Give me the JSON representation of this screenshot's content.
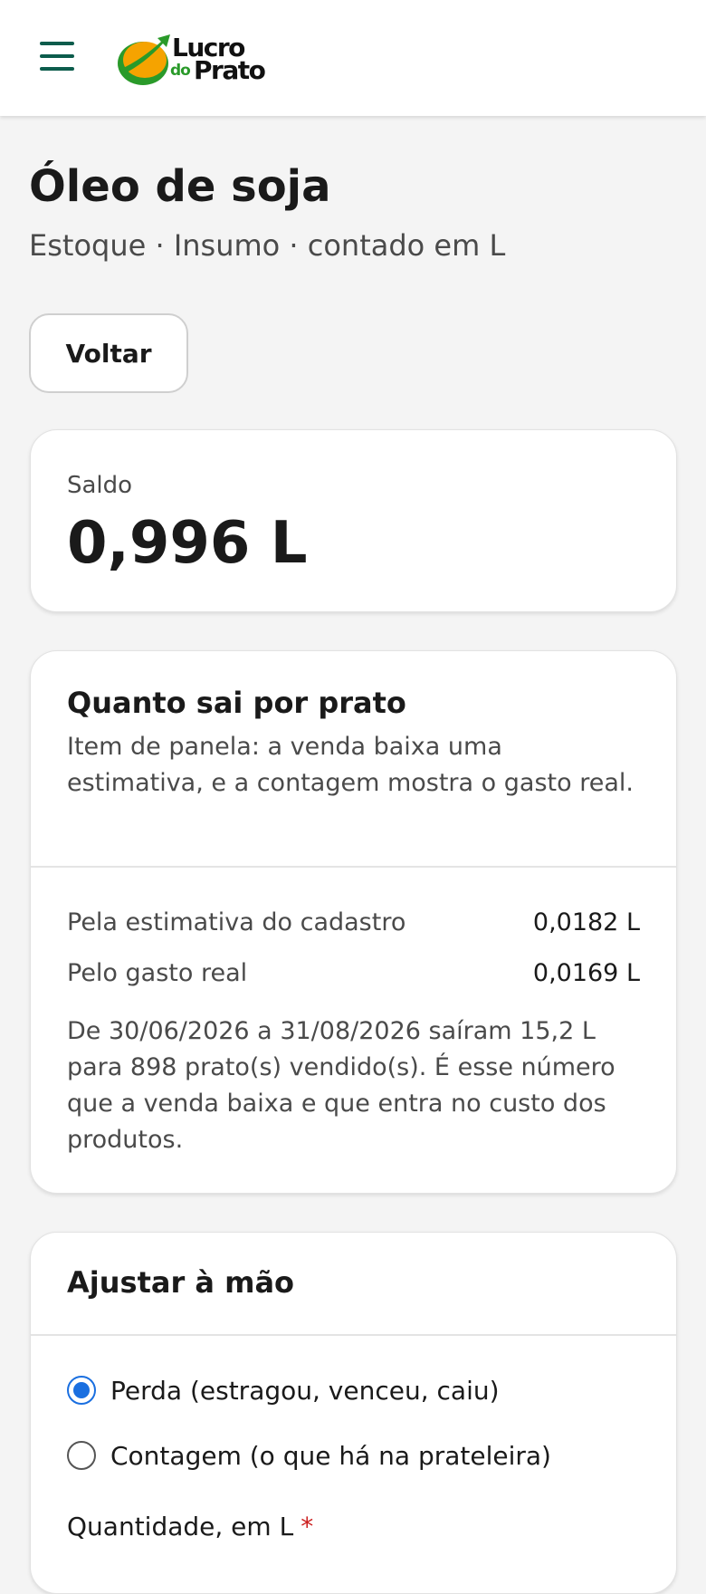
{
  "header": {
    "logo_line1": "Lucro",
    "logo_line2a": "do",
    "logo_line2b": "Prato"
  },
  "page": {
    "title": "Óleo de soja",
    "subtitle": "Estoque · Insumo · contado em L",
    "back_label": "Voltar"
  },
  "saldo": {
    "label": "Saldo",
    "value": "0,996 L"
  },
  "por_prato": {
    "title": "Quanto sai por prato",
    "description": "Item de panela: a venda baixa uma estimativa, e a contagem mostra o gasto real.",
    "rows": [
      {
        "label": "Pela estimativa do cadastro",
        "value": "0,0182 L"
      },
      {
        "label": "Pelo gasto real",
        "value": "0,0169 L"
      }
    ],
    "note": "De 30/06/2026 a 31/08/2026 saíram 15,2 L para 898 prato(s) vendido(s). É esse número que a venda baixa e que entra no custo dos produtos."
  },
  "ajuste": {
    "title": "Ajustar à mão",
    "options": [
      {
        "label": "Perda (estragou, venceu, caiu)",
        "selected": true
      },
      {
        "label": "Contagem (o que há na prateleira)",
        "selected": false
      }
    ],
    "quantity_label": "Quantidade, em L",
    "required_mark": "*"
  },
  "colors": {
    "brand_dark_green": "#0c5c4c",
    "logo_green": "#2a9a2a",
    "logo_orange": "#f5a300",
    "radio_blue": "#1a6fe0",
    "required_red": "#cc1f1f"
  }
}
